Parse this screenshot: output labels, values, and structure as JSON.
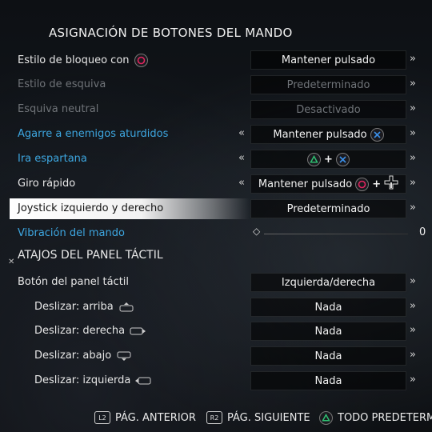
{
  "title": "ASIGNACIÓN DE BOTONES DEL MANDO",
  "rows": [
    {
      "label": "Estilo de bloqueo con",
      "value": "Mantener pulsado"
    },
    {
      "label": "Estilo de esquiva",
      "value": "Predeterminado"
    },
    {
      "label": "Esquiva neutral",
      "value": "Desactivado"
    },
    {
      "label": "Agarre a enemigos aturdidos",
      "value": "Mantener pulsado"
    },
    {
      "label": "Ira espartana",
      "value": "+"
    },
    {
      "label": "Giro rápido",
      "value": "Mantener pulsado",
      "plus": "+"
    },
    {
      "label": "Joystick izquierdo y derecho",
      "value": "Predeterminado"
    },
    {
      "label": "Vibración del mando",
      "value": "0"
    }
  ],
  "section": "ATAJOS DEL PANEL TÁCTIL",
  "touch_rows": [
    {
      "label": "Botón del panel táctil",
      "value": "Izquierda/derecha"
    },
    {
      "label": "Deslizar: arriba",
      "value": "Nada"
    },
    {
      "label": "Deslizar: derecha",
      "value": "Nada"
    },
    {
      "label": "Deslizar: abajo",
      "value": "Nada"
    },
    {
      "label": "Deslizar: izquierda",
      "value": "Nada"
    }
  ],
  "arrows": {
    "right": "»",
    "left": "«"
  },
  "footer": {
    "l2": "L2",
    "l2_label": "PÁG. ANTERIOR",
    "r2": "R2",
    "r2_label": "PÁG. SIGUIENTE",
    "triangle_label": "TODO PREDETERMI"
  },
  "colors": {
    "accent_blue": "#3da6e0",
    "circle": "#e0245e",
    "cross": "#3b8ee6",
    "triangle": "#2fbf71"
  }
}
